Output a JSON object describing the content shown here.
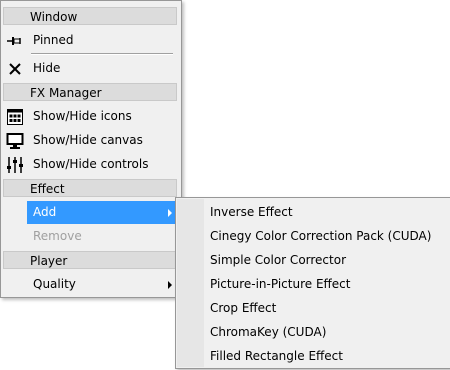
{
  "main_menu": {
    "window_header": "Window",
    "pinned": {
      "label": "Pinned",
      "icon": "pin-icon"
    },
    "hide": {
      "label": "Hide",
      "icon": "close-icon"
    },
    "fx_header": "FX Manager",
    "show_hide_icons": {
      "label": "Show/Hide icons",
      "icon": "icons-grid-icon"
    },
    "show_hide_canvas": {
      "label": "Show/Hide canvas",
      "icon": "monitor-icon"
    },
    "show_hide_controls": {
      "label": "Show/Hide controls",
      "icon": "sliders-icon"
    },
    "effect_header": "Effect",
    "add": {
      "label": "Add"
    },
    "remove": {
      "label": "Remove"
    },
    "player_header": "Player",
    "quality": {
      "label": "Quality"
    }
  },
  "submenu": {
    "items": [
      "Inverse Effect",
      "Cinegy Color Correction Pack (CUDA)",
      "Simple Color Corrector",
      "Picture-in-Picture Effect",
      "Crop Effect",
      "ChromaKey (CUDA)",
      "Filled Rectangle Effect"
    ]
  },
  "colors": {
    "highlight": "#3399ff",
    "menu_bg": "#f0f0f0",
    "header_bg": "#dcdcdc",
    "disabled_text": "#a0a0a0"
  }
}
